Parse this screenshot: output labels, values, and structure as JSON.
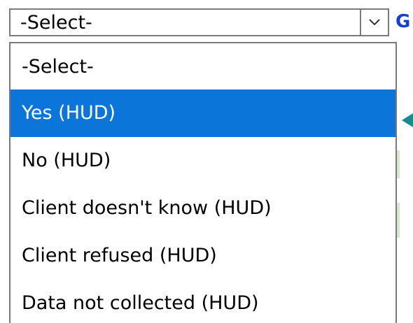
{
  "select": {
    "current_value": "-Select-",
    "arrow_icon": "chevron-down-icon"
  },
  "go_link": {
    "label": "G"
  },
  "dropdown": {
    "options": [
      {
        "label": "-Select-",
        "selected": false
      },
      {
        "label": "Yes (HUD)",
        "selected": true
      },
      {
        "label": "No (HUD)",
        "selected": false
      },
      {
        "label": "Client doesn't know (HUD)",
        "selected": false
      },
      {
        "label": "Client refused (HUD)",
        "selected": false
      },
      {
        "label": "Data not collected (HUD)",
        "selected": false
      }
    ]
  },
  "colors": {
    "highlight": "#0c75d9",
    "link": "#1c3ccf",
    "callout_arrow": "#1a8a8a",
    "border": "#7a7a7a"
  },
  "callout": {
    "icon": "pointer-arrow-icon"
  }
}
